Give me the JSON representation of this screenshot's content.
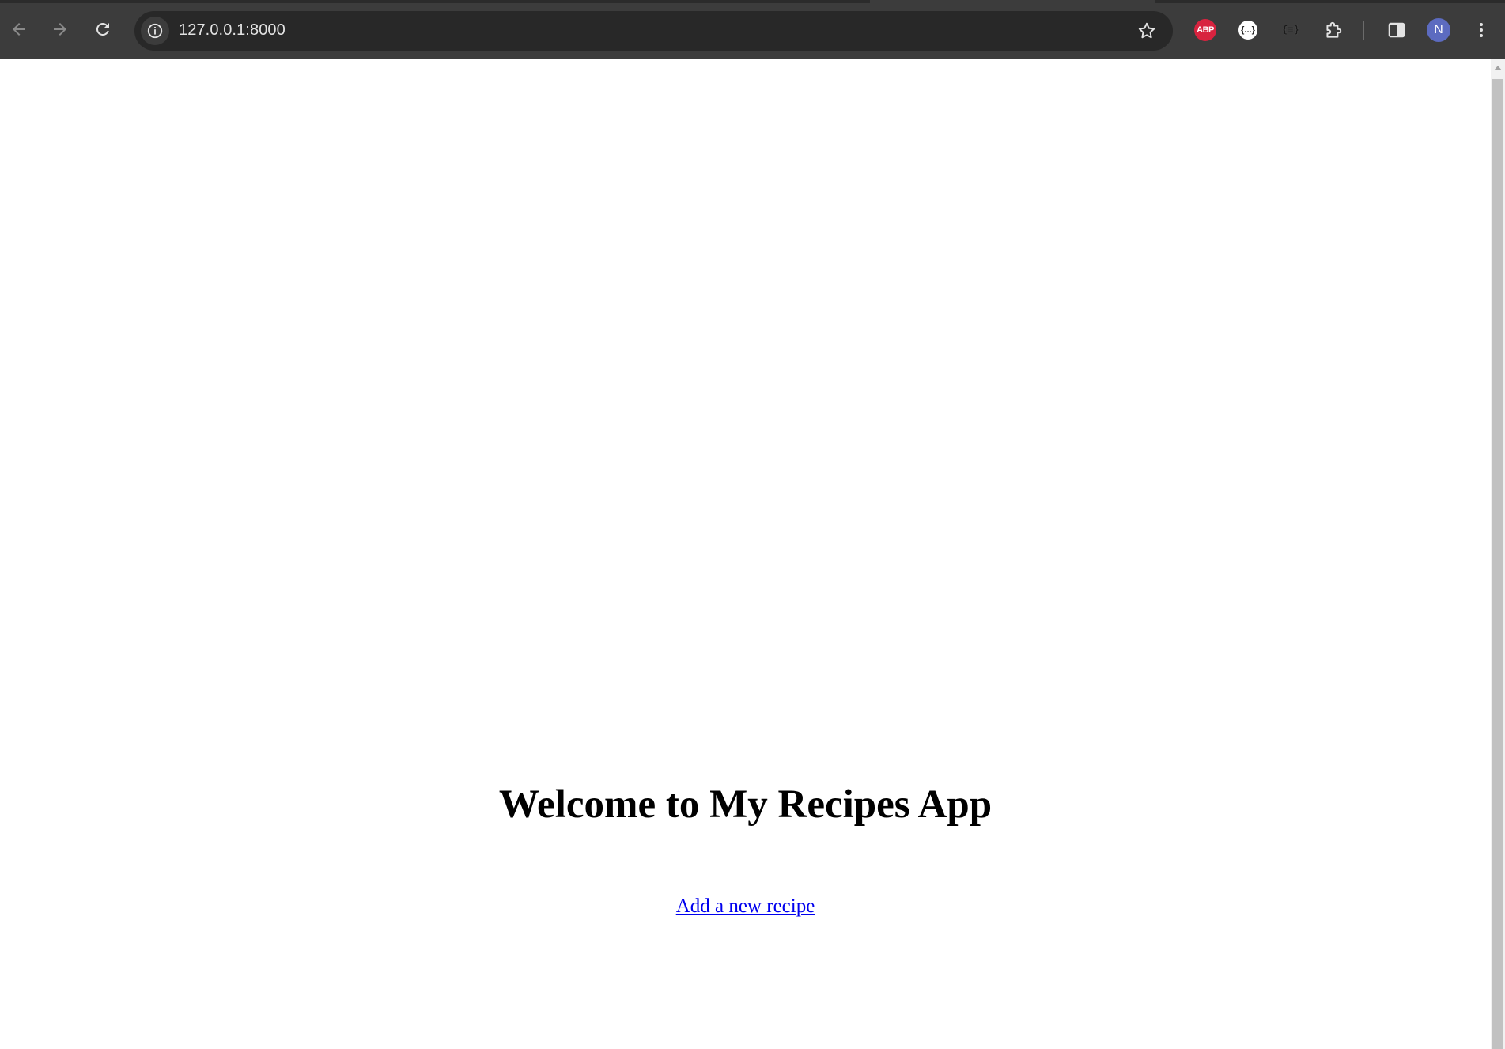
{
  "browser": {
    "url": "127.0.0.1:8000",
    "avatar_initial": "N",
    "extensions": {
      "adblock_label": "ABP",
      "json_viewer_label": "{...}",
      "json_formatter_label": "{≡}"
    },
    "icons": [
      "back-arrow-icon",
      "forward-arrow-icon",
      "reload-icon",
      "site-info-icon",
      "bookmark-star-icon",
      "puzzle-extensions-icon",
      "side-panel-icon",
      "kebab-menu-icon"
    ]
  },
  "page": {
    "title": "Welcome to My Recipes App",
    "link_label": "Add a new recipe"
  },
  "colors": {
    "toolbar": "#3c3c3c",
    "omnibox": "#282828",
    "link": "#0000ee",
    "abp": "#d8233f",
    "avatar": "#5c6bc0"
  }
}
